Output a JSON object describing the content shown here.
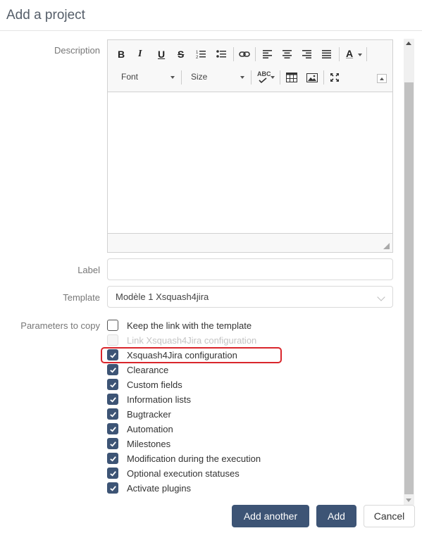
{
  "dialog": {
    "title": "Add a project"
  },
  "form": {
    "description_label": "Description",
    "label_label": "Label",
    "template_label": "Template",
    "parameters_label": "Parameters to copy",
    "label_value": "",
    "template_value": "Modèle 1 Xsquash4jira"
  },
  "editor": {
    "toolbar": {
      "bold": "B",
      "italic": "I",
      "underline": "U",
      "strike": "S",
      "font": "Font",
      "size": "Size",
      "spellcheck": "ABC",
      "text_color": "A"
    }
  },
  "parameters": [
    {
      "label": "Keep the link with the template",
      "checked": false,
      "disabled": false
    },
    {
      "label": "Link Xsquash4Jira configuration",
      "checked": false,
      "disabled": true
    },
    {
      "label": "Xsquash4Jira configuration",
      "checked": true,
      "disabled": false,
      "highlighted": true
    },
    {
      "label": "Clearance",
      "checked": true,
      "disabled": false
    },
    {
      "label": "Custom fields",
      "checked": true,
      "disabled": false
    },
    {
      "label": "Information lists",
      "checked": true,
      "disabled": false
    },
    {
      "label": "Bugtracker",
      "checked": true,
      "disabled": false
    },
    {
      "label": "Automation",
      "checked": true,
      "disabled": false
    },
    {
      "label": "Milestones",
      "checked": true,
      "disabled": false
    },
    {
      "label": "Modification during the execution",
      "checked": true,
      "disabled": false
    },
    {
      "label": "Optional execution statuses",
      "checked": true,
      "disabled": false
    },
    {
      "label": "Activate plugins",
      "checked": true,
      "disabled": false
    }
  ],
  "buttons": {
    "add_another": "Add another",
    "add": "Add",
    "cancel": "Cancel"
  },
  "colors": {
    "primary": "#3d5475",
    "highlight": "#d9262c"
  }
}
